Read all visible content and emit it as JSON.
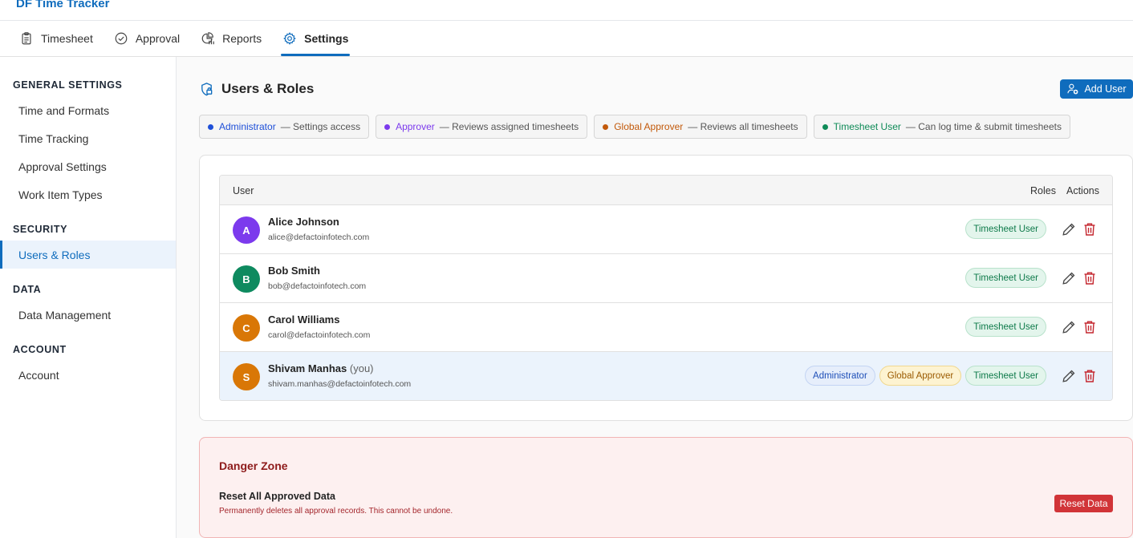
{
  "app": {
    "title": "DF Time Tracker"
  },
  "tabs": [
    {
      "label": "Timesheet",
      "icon": "clipboard-icon"
    },
    {
      "label": "Approval",
      "icon": "check-circle-icon"
    },
    {
      "label": "Reports",
      "icon": "reports-icon"
    },
    {
      "label": "Settings",
      "icon": "gear-icon",
      "active": true
    }
  ],
  "sidebar": {
    "sections": [
      {
        "heading": "GENERAL SETTINGS",
        "items": [
          "Time and Formats",
          "Time Tracking",
          "Approval Settings",
          "Work Item Types"
        ]
      },
      {
        "heading": "SECURITY",
        "items": [
          "Users & Roles"
        ]
      },
      {
        "heading": "DATA",
        "items": [
          "Data Management"
        ]
      },
      {
        "heading": "ACCOUNT",
        "items": [
          "Account"
        ]
      }
    ],
    "active_item": "Users & Roles"
  },
  "page": {
    "title": "Users & Roles",
    "title_icon": "shield-lock-icon",
    "add_user_label": "Add User",
    "add_user_icon": "person-add-icon"
  },
  "legend": [
    {
      "role": "Administrator",
      "desc": "— Settings access",
      "color": "#1e4fd8"
    },
    {
      "role": "Approver",
      "desc": "— Reviews assigned timesheets",
      "color": "#7c3aed"
    },
    {
      "role": "Global Approver",
      "desc": "— Reviews all timesheets",
      "color": "#c2590a"
    },
    {
      "role": "Timesheet User",
      "desc": "— Can log time & submit timesheets",
      "color": "#0e8a57"
    }
  ],
  "table": {
    "headers": {
      "user": "User",
      "roles": "Roles",
      "actions": "Actions"
    },
    "rows": [
      {
        "initial": "A",
        "avatar_color": "#7c3aed",
        "name": "Alice Johnson",
        "you": "",
        "email": "alice@defactoinfotech.com",
        "roles": [
          "Timesheet User"
        ]
      },
      {
        "initial": "B",
        "avatar_color": "#0e8a5f",
        "name": "Bob Smith",
        "you": "",
        "email": "bob@defactoinfotech.com",
        "roles": [
          "Timesheet User"
        ]
      },
      {
        "initial": "C",
        "avatar_color": "#d97706",
        "name": "Carol Williams",
        "you": "",
        "email": "carol@defactoinfotech.com",
        "roles": [
          "Timesheet User"
        ]
      },
      {
        "initial": "S",
        "avatar_color": "#d97706",
        "name": "Shivam Manhas",
        "you": "(you)",
        "email": "shivam.manhas@defactoinfotech.com",
        "roles": [
          "Administrator",
          "Global Approver",
          "Timesheet User"
        ]
      }
    ]
  },
  "danger_zone": {
    "title": "Danger Zone",
    "item_title": "Reset All Approved Data",
    "item_desc": "Permanently deletes all approval records. This cannot be undone.",
    "button_label": "Reset Data",
    "color": "#d13438"
  }
}
